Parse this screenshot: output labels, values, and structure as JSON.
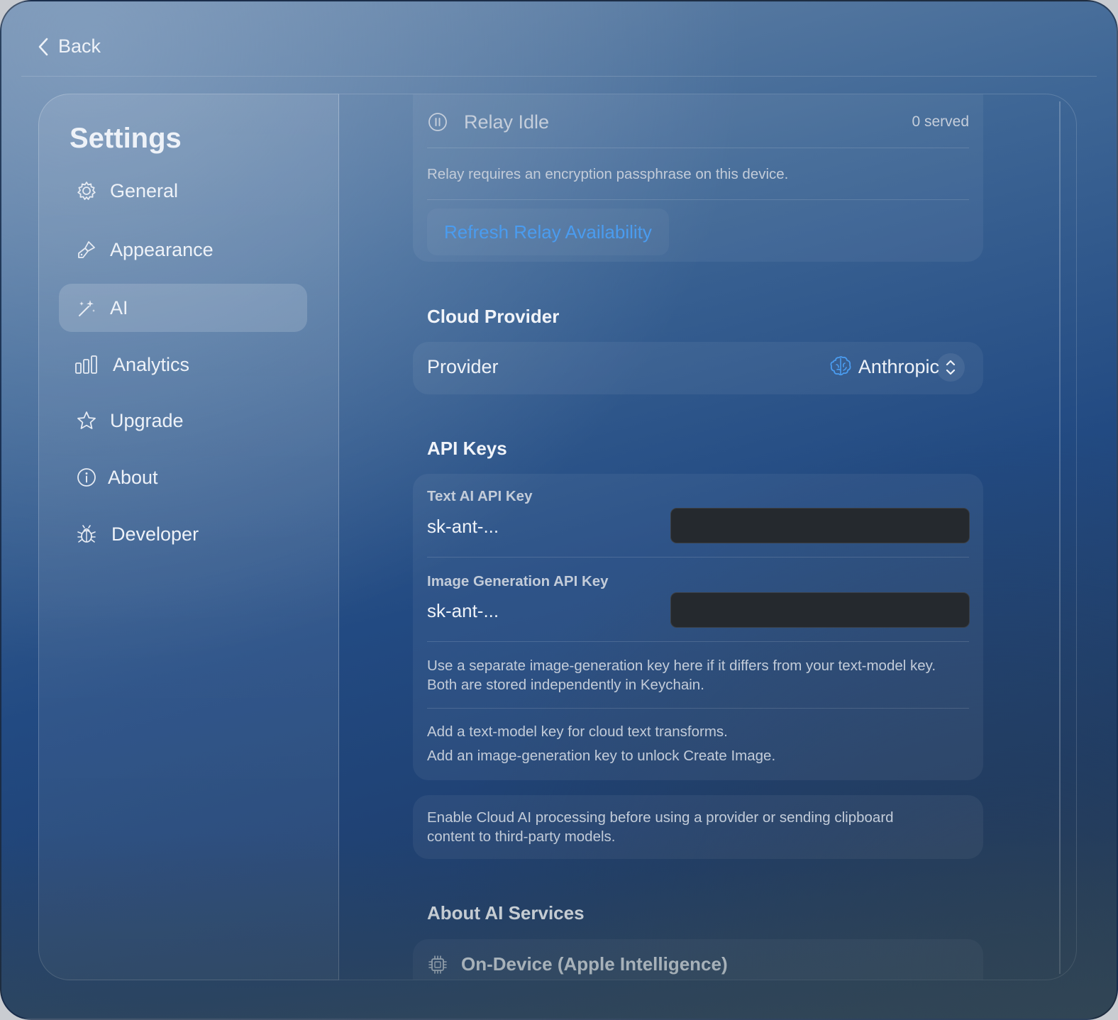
{
  "top_bar": {
    "back_label": "Back"
  },
  "sidebar": {
    "title": "Settings",
    "items": [
      {
        "label": "General",
        "icon": "gear-icon"
      },
      {
        "label": "Appearance",
        "icon": "paintbrush-icon"
      },
      {
        "label": "AI",
        "icon": "magic-wand-icon",
        "active": true
      },
      {
        "label": "Analytics",
        "icon": "bar-chart-icon"
      },
      {
        "label": "Upgrade",
        "icon": "star-icon"
      },
      {
        "label": "About",
        "icon": "info-icon"
      },
      {
        "label": "Developer",
        "icon": "bug-icon"
      }
    ]
  },
  "relay": {
    "status": "Relay Idle",
    "served": "0 served",
    "note": "Relay requires an encryption passphrase on this device.",
    "refresh_label": "Refresh Relay Availability"
  },
  "cloud_provider": {
    "section_title": "Cloud Provider",
    "provider_label": "Provider",
    "provider_value": "Anthropic"
  },
  "api_keys": {
    "section_title": "API Keys",
    "text_key_label": "Text AI API Key",
    "text_key_placeholder": "sk-ant-...",
    "image_key_label": "Image Generation API Key",
    "image_key_placeholder": "sk-ant-...",
    "separate_key_note": "Use a separate image-generation key here if it differs from your text-model key. Both are stored independently in Keychain.",
    "add_text_key_note": "Add a text-model key for cloud text transforms.",
    "add_image_key_note": "Add an image-generation key to unlock Create Image."
  },
  "cloud_notice": "Enable Cloud AI processing before using a provider or sending clipboard content to third-party models.",
  "about_services": {
    "section_title": "About AI Services",
    "on_device_title": "On-Device (Apple Intelligence)"
  },
  "colors": {
    "accent": "#4a9cf0",
    "key_field": "#25292e"
  }
}
